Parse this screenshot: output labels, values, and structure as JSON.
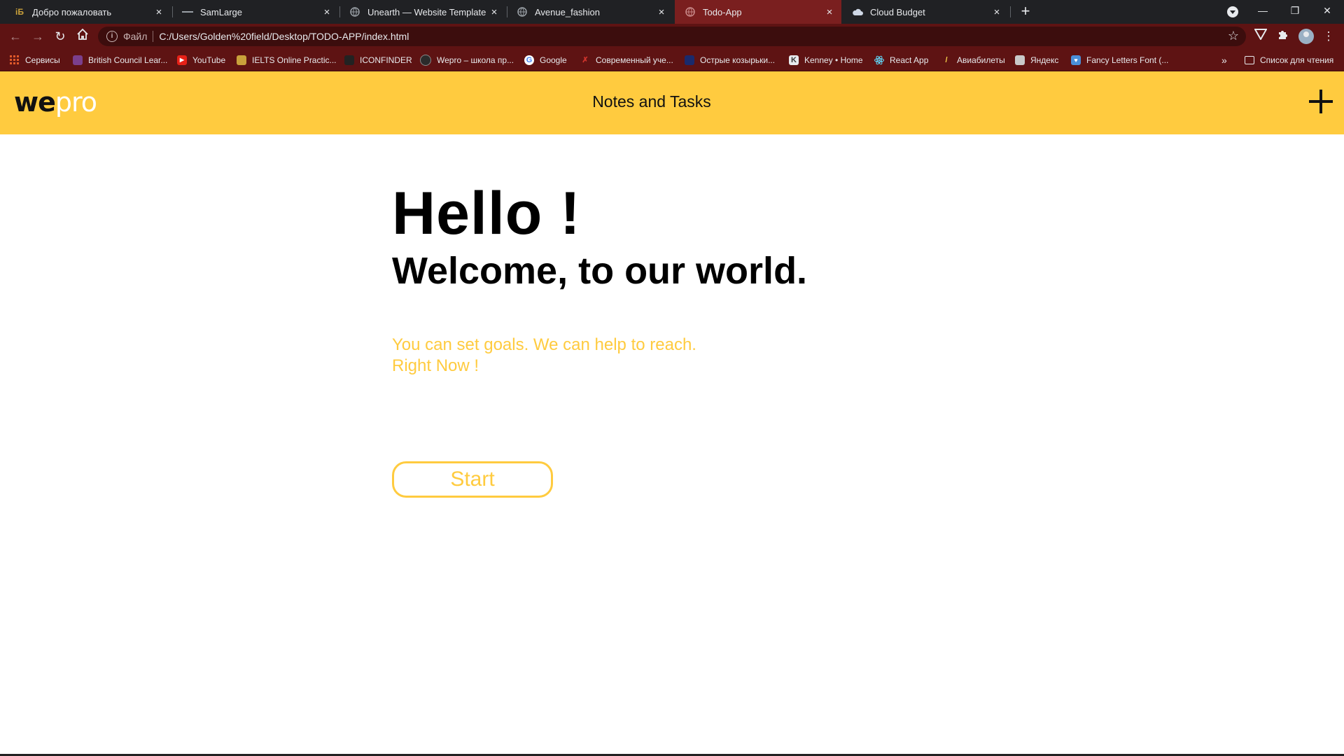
{
  "browser": {
    "tabs": [
      {
        "title": "Добро пожаловать",
        "favicon": "iБ",
        "active": false
      },
      {
        "title": "SamLarge",
        "favicon": "dash-icon",
        "active": false
      },
      {
        "title": "Unearth — Website Template by",
        "favicon": "globe-icon",
        "active": false
      },
      {
        "title": "Avenue_fashion",
        "favicon": "globe-icon",
        "active": false
      },
      {
        "title": "Todo-App",
        "favicon": "globe-icon",
        "active": true
      },
      {
        "title": "Cloud Budget",
        "favicon": "cloud-icon",
        "active": false
      }
    ],
    "tab_close": "×",
    "new_tab": "+",
    "window_controls": {
      "minimize": "—",
      "restore": "❐",
      "close": "✕"
    },
    "address": {
      "scheme_label": "Файл",
      "url": "C:/Users/Golden%20field/Desktop/TODO-APP/index.html"
    },
    "bookmarks": [
      {
        "label": "Сервисы",
        "color": "#e05a2a"
      },
      {
        "label": "British Council Lear...",
        "color": "#7b3f8c"
      },
      {
        "label": "YouTube",
        "color": "#e62117"
      },
      {
        "label": "IELTS Online Practic...",
        "color": "#c9a13b"
      },
      {
        "label": "ICONFINDER",
        "color": "#222222"
      },
      {
        "label": "Wepro – школа пр...",
        "color": "#2b2b2b"
      },
      {
        "label": "Google",
        "color": "#ffffff"
      },
      {
        "label": "Современный уче...",
        "color": "#d0342c"
      },
      {
        "label": "Острые козырьки...",
        "color": "#1a2a6c"
      },
      {
        "label": "Kenney • Home",
        "color": "#3a3a3a"
      },
      {
        "label": "React App",
        "color": "#61dafb"
      },
      {
        "label": "Авиабилеты",
        "color": "#f5d04a"
      },
      {
        "label": "Яндекс",
        "color": "#c9c9c9"
      },
      {
        "label": "Fancy Letters Font (...",
        "color": "#4a90d9"
      }
    ],
    "bookmarks_more": "»",
    "reading_list": "Список для чтения"
  },
  "app": {
    "logo_we": "we",
    "logo_pro": "pro",
    "header_title": "Notes and Tasks",
    "hero_title": "Hello !",
    "hero_subtitle": "Welcome, to our world.",
    "tagline_line1": "You can set goals. We can help to reach.",
    "tagline_line2": "Right Now !",
    "start_label": "Start",
    "accent_color": "#ffcb3f"
  }
}
